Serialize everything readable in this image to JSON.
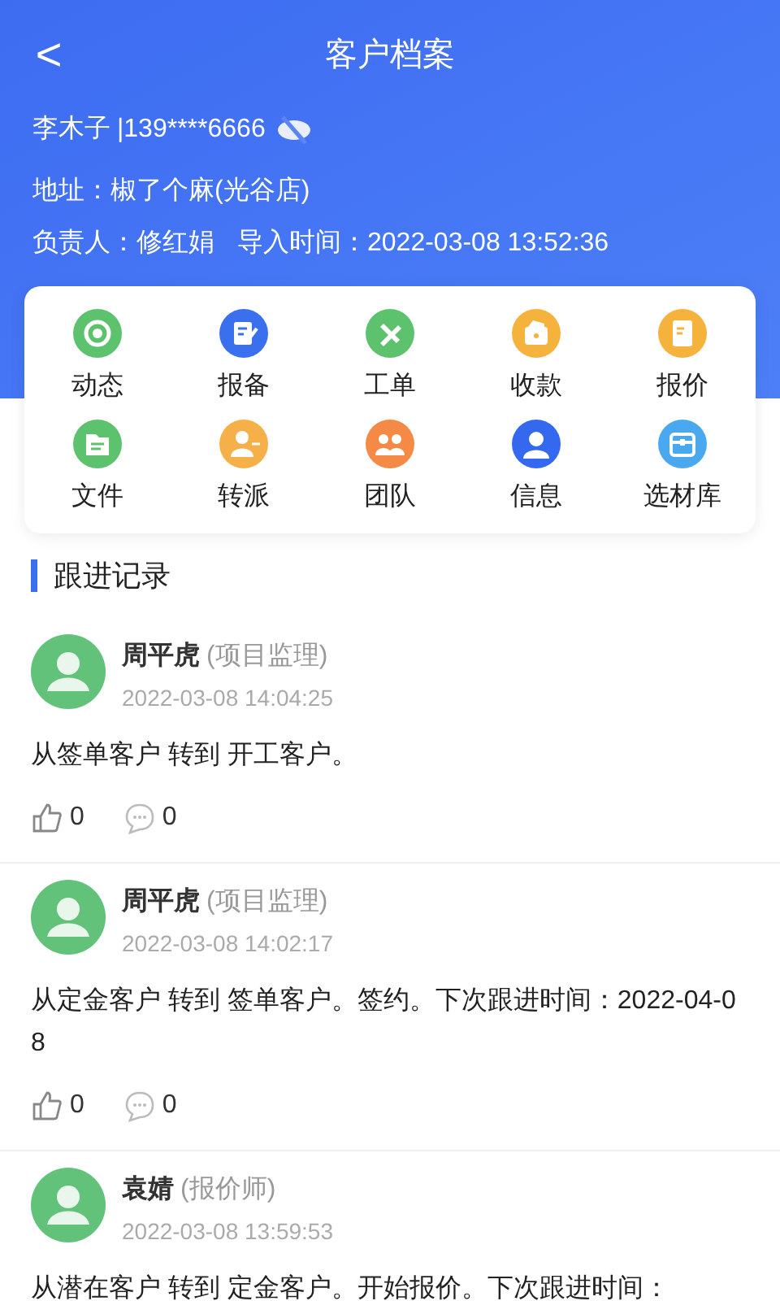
{
  "header": {
    "back": "<",
    "title": "客户档案"
  },
  "customer": {
    "name": "李木子",
    "phone": "|139****6666",
    "address_label": "地址：",
    "address": "椒了个麻(光谷店)",
    "owner_label": "负责人：",
    "owner": "修红娟",
    "import_label": "导入时间：",
    "import_time": "2022-03-08 13:52:36"
  },
  "menu": [
    {
      "label": "动态",
      "color": "#5cc26e"
    },
    {
      "label": "报备",
      "color": "#3a70ee"
    },
    {
      "label": "工单",
      "color": "#5cc26e"
    },
    {
      "label": "收款",
      "color": "#f5b23d"
    },
    {
      "label": "报价",
      "color": "#f5b23d"
    },
    {
      "label": "文件",
      "color": "#5cc26e"
    },
    {
      "label": "转派",
      "color": "#f5b04a"
    },
    {
      "label": "团队",
      "color": "#f58a47"
    },
    {
      "label": "信息",
      "color": "#3468ee"
    },
    {
      "label": "选材库",
      "color": "#4aa8ee"
    }
  ],
  "section_title": "跟进记录",
  "records": [
    {
      "name": "周平虎",
      "role": "(项目监理)",
      "time": "2022-03-08 14:04:25",
      "text": "从签单客户 转到 开工客户。",
      "likes": "0",
      "comments": "0"
    },
    {
      "name": "周平虎",
      "role": "(项目监理)",
      "time": "2022-03-08 14:02:17",
      "text": "从定金客户 转到 签单客户。签约。下次跟进时间：2022-04-08",
      "likes": "0",
      "comments": "0"
    },
    {
      "name": "袁婧",
      "role": "(报价师)",
      "time": "2022-03-08 13:59:53",
      "text": "从潜在客户 转到 定金客户。开始报价。下次跟进时间："
    }
  ]
}
